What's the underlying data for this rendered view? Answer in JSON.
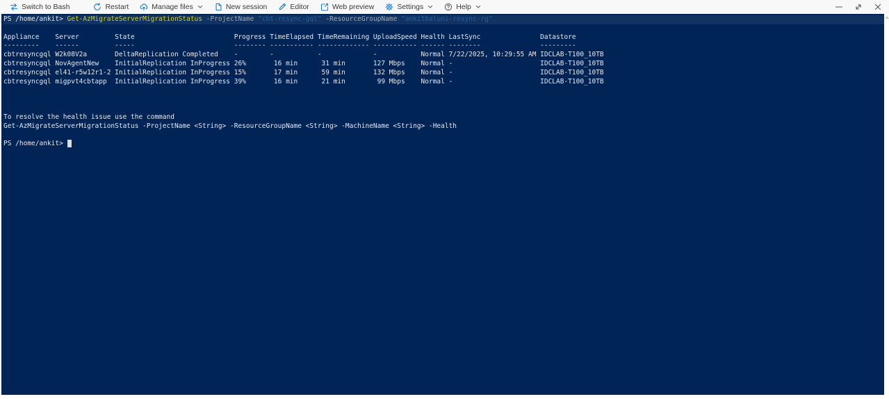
{
  "theme": {
    "toolbar-bg": "#f8f8f8",
    "toolbar-text": "#3b3a39",
    "icon-blue": "#1a7fd6",
    "icon-gray": "#605e5c",
    "terminal-bg": "#012456",
    "text-plain": "#e9e8ec",
    "text-command": "#d2d200",
    "text-parameter": "#a2a9b0",
    "text-string": "#1e62a8"
  },
  "toolbar": {
    "buttons": [
      {
        "id": "switch-to-bash",
        "label": "Switch to Bash",
        "icon": "switch-arrows-icon",
        "dropdown": false
      },
      {
        "id": "restart",
        "label": "Restart",
        "icon": "restart-icon",
        "dropdown": false
      },
      {
        "id": "manage-files",
        "label": "Manage files",
        "icon": "cloud-upload-icon",
        "dropdown": true
      },
      {
        "id": "new-session",
        "label": "New session",
        "icon": "new-file-icon",
        "dropdown": false
      },
      {
        "id": "editor",
        "label": "Editor",
        "icon": "pencil-icon",
        "dropdown": false
      },
      {
        "id": "web-preview",
        "label": "Web preview",
        "icon": "web-preview-icon",
        "dropdown": false
      },
      {
        "id": "settings",
        "label": "Settings",
        "icon": "gear-icon",
        "dropdown": true
      },
      {
        "id": "help",
        "label": "Help",
        "icon": "help-icon",
        "dropdown": true,
        "tint": "gray"
      }
    ],
    "window_controls": [
      {
        "id": "minimize",
        "icon": "minimize-icon"
      },
      {
        "id": "restore",
        "icon": "resize-diagonal-icon"
      },
      {
        "id": "close",
        "icon": "close-icon"
      }
    ]
  },
  "terminal": {
    "prompt": "PS /home/ankit> ",
    "command": "Get-AzMigrateServerMigrationStatus -ProjectName \"cbt-resync-gql\" -ResourceGroupName \"ankitbaluni-resync-rg\"",
    "lines": [
      {
        "hl": true,
        "seg": [
          {
            "t": "PS /home/ankit> ",
            "c": "p"
          },
          {
            "t": "Get-AzMigrateServerMigrationStatus",
            "c": "c"
          },
          {
            "t": " ",
            "c": "p"
          },
          {
            "t": "-ProjectName",
            "c": "a"
          },
          {
            "t": " ",
            "c": "p"
          },
          {
            "t": "\"cbt-resync-gql\"",
            "c": "s"
          },
          {
            "t": " ",
            "c": "p"
          },
          {
            "t": "-ResourceGroupName",
            "c": "a"
          },
          {
            "t": " ",
            "c": "p"
          },
          {
            "t": "\"ankitbaluni-resync-rg\"",
            "c": "s"
          }
        ]
      },
      {
        "seg": []
      },
      {
        "table": true
      },
      {
        "seg": []
      },
      {
        "seg": []
      },
      {
        "seg": []
      },
      {
        "seg": [
          {
            "t": "To resolve the health issue use the command",
            "c": "p"
          }
        ]
      },
      {
        "seg": [
          {
            "t": "Get-AzMigrateServerMigrationStatus -ProjectName <String> -ResourceGroupName <String> -MachineName <String> -Health",
            "c": "p"
          }
        ]
      },
      {
        "seg": []
      },
      {
        "cursor": true,
        "seg": [
          {
            "t": "PS /home/ankit> ",
            "c": "p"
          }
        ]
      }
    ],
    "table": {
      "columns": [
        {
          "name": "Appliance",
          "width": 13
        },
        {
          "name": "Server",
          "width": 15
        },
        {
          "name": "State",
          "width": 30
        },
        {
          "name": "Progress",
          "width": 9
        },
        {
          "name": "TimeElapsed",
          "width": 12
        },
        {
          "name": "TimeRemaining",
          "width": 14
        },
        {
          "name": "UploadSpeed",
          "width": 12
        },
        {
          "name": "Health",
          "width": 7
        },
        {
          "name": "LastSync",
          "width": 23
        },
        {
          "name": "Datastore",
          "width": 16
        }
      ],
      "rows": [
        [
          "cbtresyncgql",
          "W2k08V2a",
          "DeltaReplication Completed",
          "-",
          "-",
          "-",
          "-",
          "Normal",
          "7/22/2025, 10:29:55 AM",
          "IDCLAB-T100_10TB"
        ],
        [
          "cbtresyncgql",
          "NovAgentNew",
          "InitialReplication InProgress",
          "26%",
          " 16 min",
          " 31 min",
          "127 Mbps",
          "Normal",
          "-",
          "IDCLAB-T100_10TB"
        ],
        [
          "cbtresyncgql",
          "el41-r5w12r1-2",
          "InitialReplication InProgress",
          "15%",
          " 17 min",
          " 59 min",
          "132 Mbps",
          "Normal",
          "-",
          "IDCLAB-T100_10TB"
        ],
        [
          "cbtresyncgql",
          "migpvt4cbtapp",
          "InitialReplication InProgress",
          "39%",
          " 16 min",
          " 21 min",
          " 99 Mbps",
          "Normal",
          "-",
          "IDCLAB-T100_10TB"
        ]
      ]
    }
  }
}
